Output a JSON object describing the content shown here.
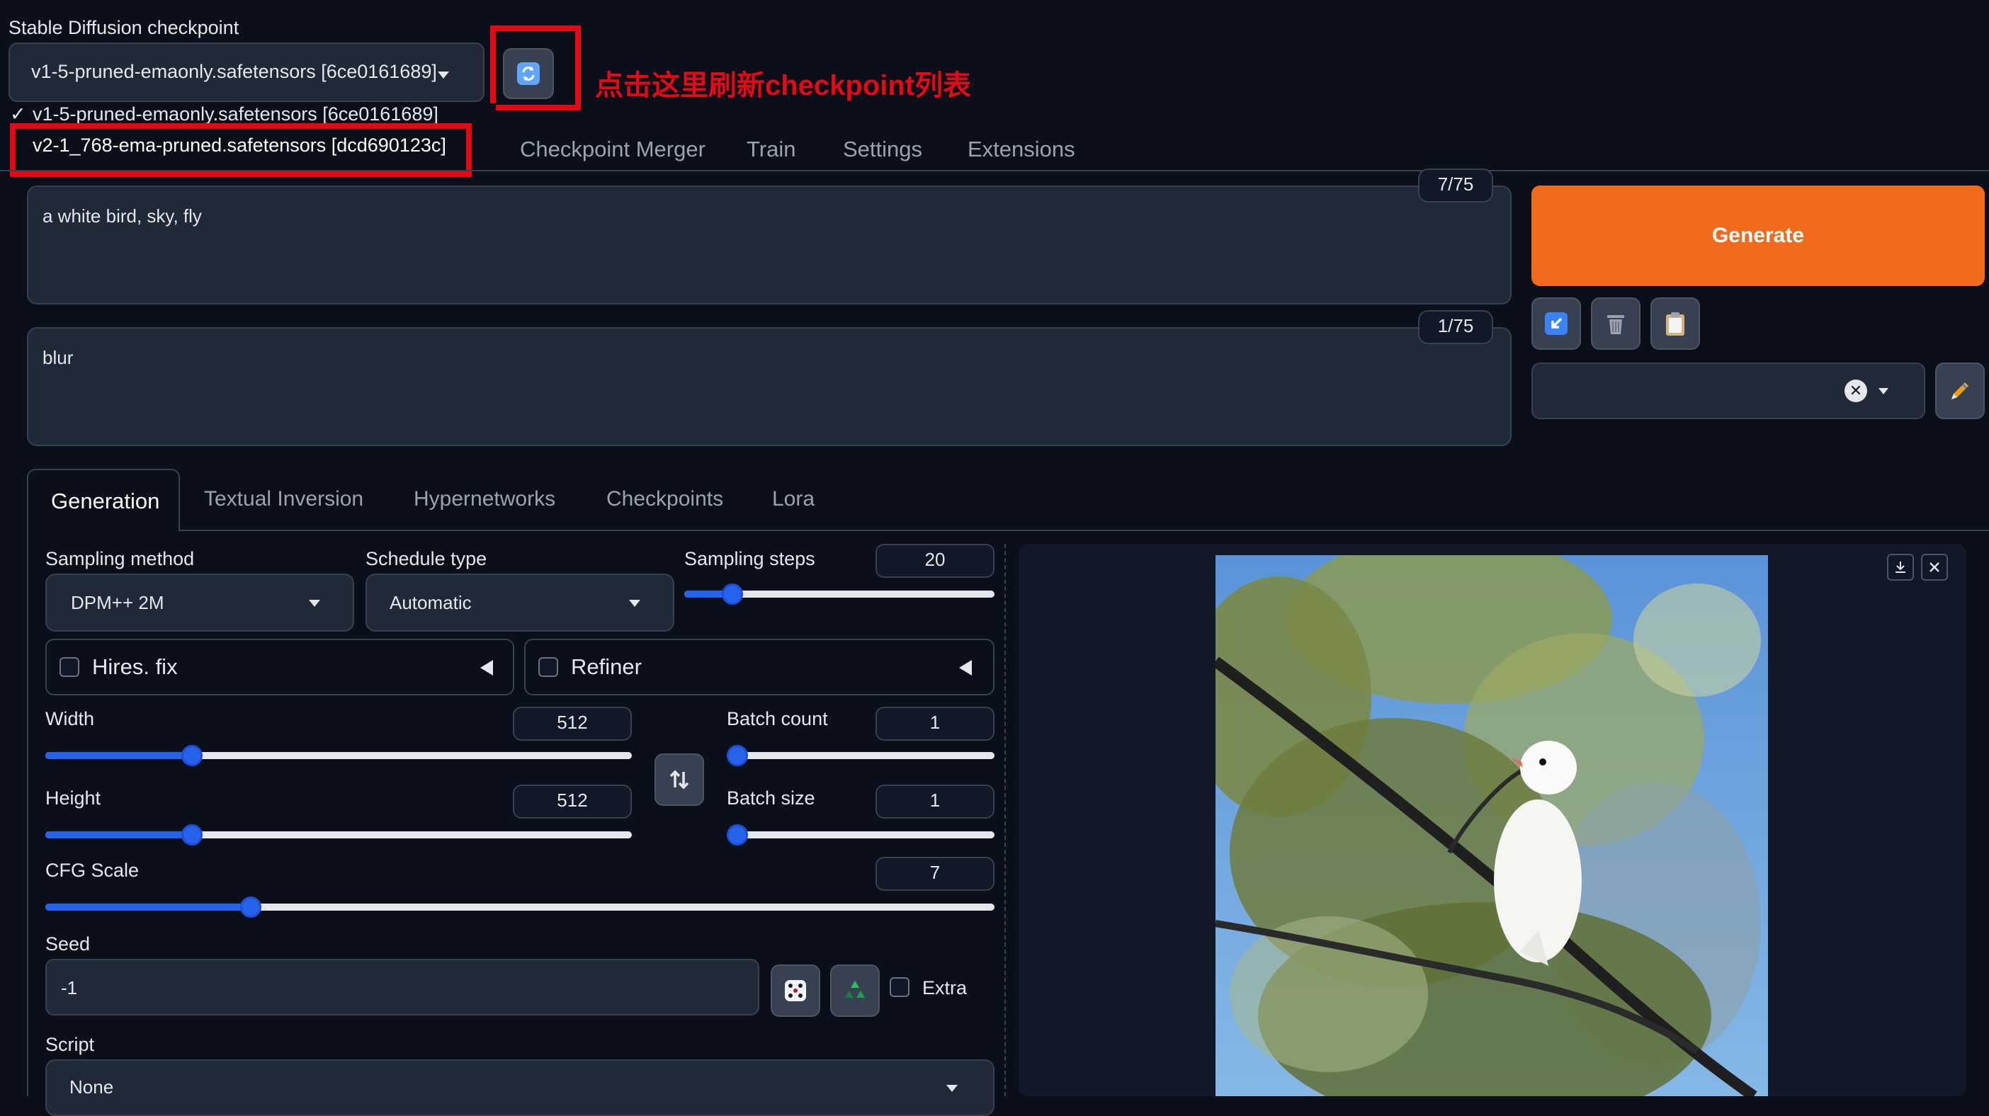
{
  "checkpoint": {
    "label": "Stable Diffusion checkpoint",
    "selected": "v1-5-pruned-emaonly.safetensors [6ce0161689]",
    "options": [
      {
        "check": "✓",
        "text": "v1-5-pruned-emaonly.safetensors [6ce0161689]"
      },
      {
        "check": "",
        "text": "v2-1_768-ema-pruned.safetensors [dcd690123c]"
      }
    ],
    "annotation": "点击这里刷新checkpoint列表"
  },
  "main_tabs": [
    "Checkpoint Merger",
    "Train",
    "Settings",
    "Extensions"
  ],
  "prompt": {
    "text": "a white bird, sky, fly",
    "counter": "7/75"
  },
  "negative_prompt": {
    "text": "blur",
    "counter": "1/75"
  },
  "generate_label": "Generate",
  "sub_tabs": [
    "Generation",
    "Textual Inversion",
    "Hypernetworks",
    "Checkpoints",
    "Lora"
  ],
  "sampling": {
    "method_label": "Sampling method",
    "method_value": "DPM++ 2M",
    "schedule_label": "Schedule type",
    "schedule_value": "Automatic",
    "steps_label": "Sampling steps",
    "steps_value": "20",
    "steps_fraction": 0.13
  },
  "hires_fix_label": "Hires. fix",
  "refiner_label": "Refiner",
  "width": {
    "label": "Width",
    "value": "512",
    "fraction": 0.24
  },
  "height": {
    "label": "Height",
    "value": "512",
    "fraction": 0.24
  },
  "batch_count": {
    "label": "Batch count",
    "value": "1",
    "fraction": 0.0
  },
  "batch_size": {
    "label": "Batch size",
    "value": "1",
    "fraction": 0.0
  },
  "cfg": {
    "label": "CFG Scale",
    "value": "7",
    "fraction": 0.21
  },
  "seed": {
    "label": "Seed",
    "value": "-1",
    "extra_label": "Extra"
  },
  "script": {
    "label": "Script",
    "value": "None"
  },
  "icons": {
    "refresh": "refresh-icon",
    "read_params": "arrow-down-left-icon",
    "trash": "trash-icon",
    "clipboard": "clipboard-icon",
    "clear": "close-icon",
    "edit": "pencil-icon",
    "swap": "swap-vertical-icon",
    "dice": "dice-icon",
    "recycle": "recycle-icon",
    "download": "download-icon",
    "close": "close-icon"
  },
  "colors": {
    "generate": "#f26b1d",
    "accent": "#2563eb",
    "annotation": "#e50914"
  }
}
